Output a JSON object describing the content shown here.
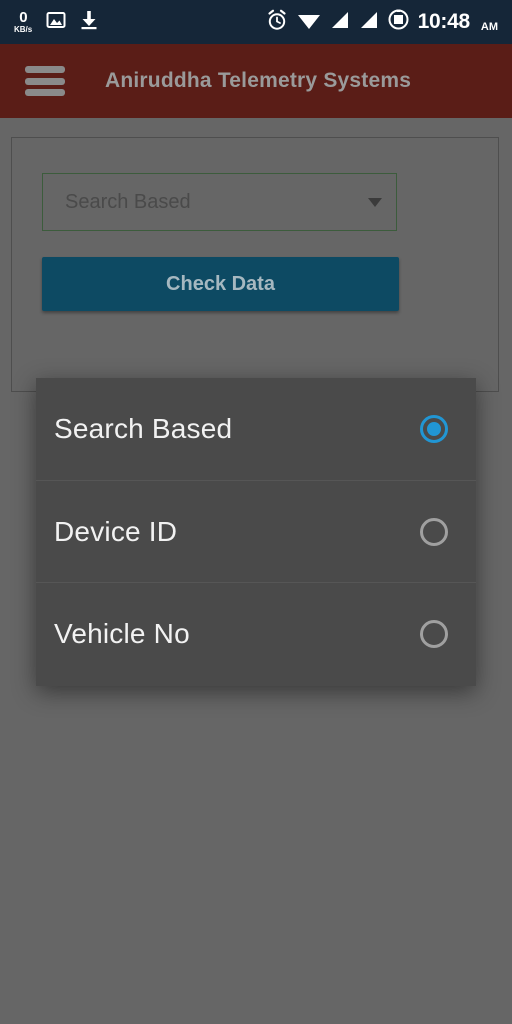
{
  "status_bar": {
    "network_speed_value": "0",
    "network_speed_unit": "KB/s",
    "icons": [
      "image-icon",
      "download-icon",
      "alarm-icon",
      "wifi-icon",
      "signal-icon-1",
      "signal-icon-2",
      "battery-icon"
    ],
    "time": "10:48",
    "meridiem": "AM",
    "background_color": "#152638"
  },
  "app_bar": {
    "menu_icon": "hamburger-menu-icon",
    "title": "Aniruddha Telemetry Systems",
    "background_color": "#5a1d17",
    "title_color": "#9a9a9a"
  },
  "card": {
    "select": {
      "value": "Search Based",
      "arrow_icon": "chevron-down-icon",
      "border_color": "#3c5c3c"
    },
    "check_button": {
      "label": "Check Data",
      "background_color": "#0d4a63"
    }
  },
  "dialog": {
    "background_color": "#4a4a4a",
    "accent_color": "#2196d4",
    "options": [
      {
        "label": "Search Based",
        "selected": true
      },
      {
        "label": "Device ID",
        "selected": false
      },
      {
        "label": "Vehicle No",
        "selected": false
      }
    ]
  },
  "screen": {
    "background_color": "#666666"
  }
}
